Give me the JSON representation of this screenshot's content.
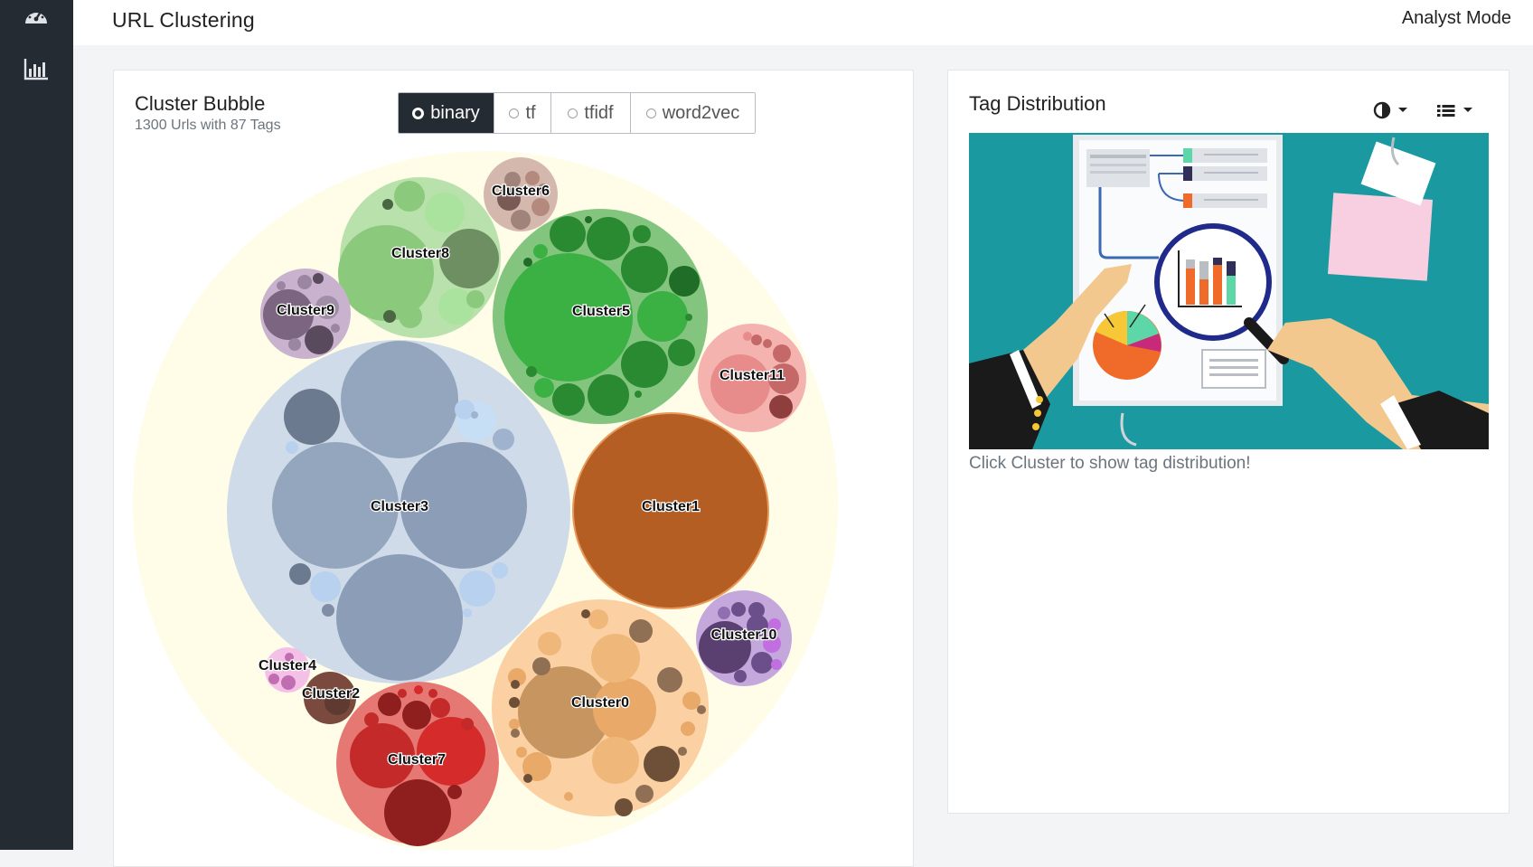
{
  "header": {
    "title": "URL Clustering",
    "mode": "Analyst Mode"
  },
  "sidebar": {
    "items": [
      {
        "icon": "dashboard-icon"
      },
      {
        "icon": "bar-chart-icon"
      }
    ]
  },
  "cluster_panel": {
    "title": "Cluster Bubble",
    "subtitle": "1300 Urls with 87 Tags",
    "methods": [
      {
        "label": "binary",
        "selected": true
      },
      {
        "label": "tf",
        "selected": false
      },
      {
        "label": "tfidf",
        "selected": false
      },
      {
        "label": "word2vec",
        "selected": false
      }
    ],
    "clusters": [
      {
        "name": "Cluster0",
        "color": "#e8a969"
      },
      {
        "name": "Cluster1",
        "color": "#b55e23"
      },
      {
        "name": "Cluster2",
        "color": "#7a4a3e"
      },
      {
        "name": "Cluster3",
        "color": "#8fa0bb"
      },
      {
        "name": "Cluster4",
        "color": "#e7a0d6"
      },
      {
        "name": "Cluster5",
        "color": "#3bb143"
      },
      {
        "name": "Cluster6",
        "color": "#b48a7f"
      },
      {
        "name": "Cluster7",
        "color": "#d62b2b"
      },
      {
        "name": "Cluster8",
        "color": "#8bc97c"
      },
      {
        "name": "Cluster9",
        "color": "#7b6580"
      },
      {
        "name": "Cluster10",
        "color": "#6b4f8a"
      },
      {
        "name": "Cluster11",
        "color": "#e88b8b"
      }
    ]
  },
  "tag_panel": {
    "title": "Tag Distribution",
    "icons": [
      "contrast-icon",
      "list-icon"
    ],
    "hint": "Click Cluster to show tag distribution!"
  }
}
